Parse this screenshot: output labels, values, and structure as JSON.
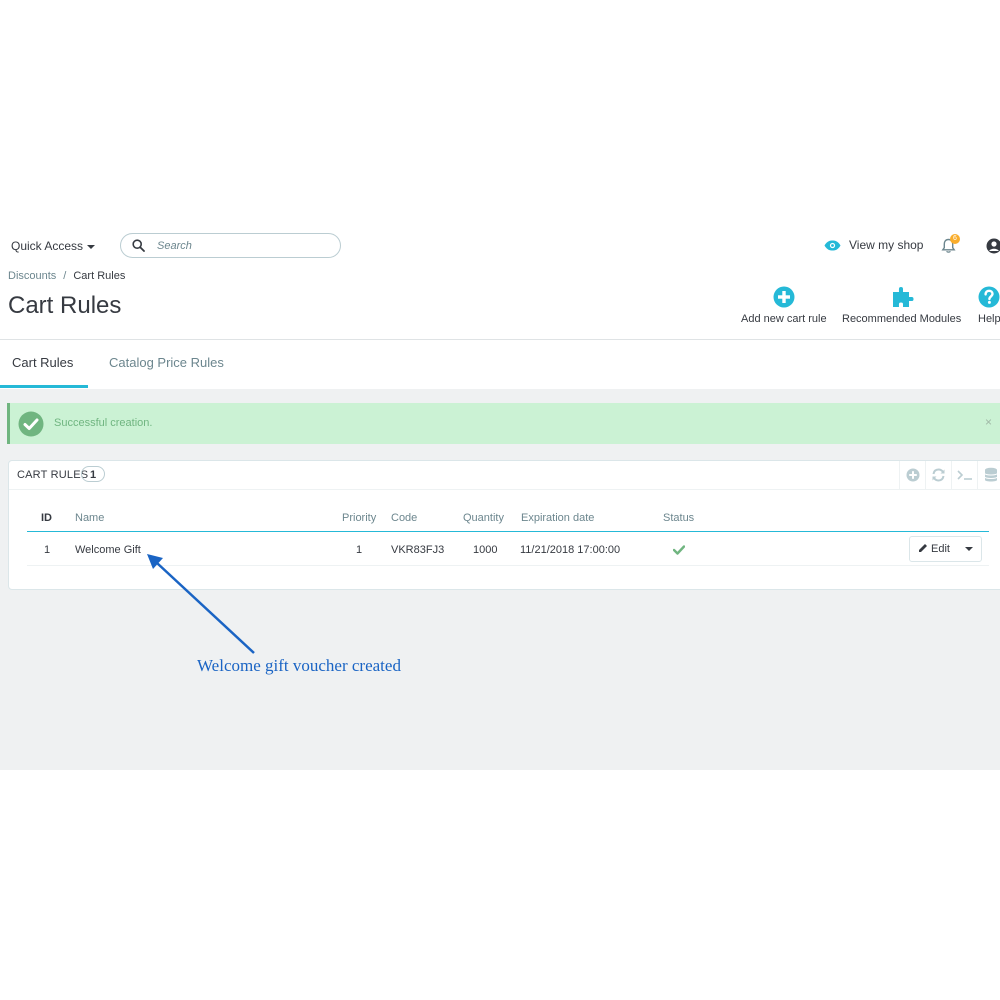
{
  "header": {
    "quick_access": "Quick Access",
    "search_placeholder": "Search",
    "view_shop": "View my shop",
    "notification_count": "6"
  },
  "breadcrumb": {
    "parent": "Discounts",
    "separator": "/",
    "current": "Cart Rules"
  },
  "page_title": "Cart Rules",
  "toolbar": {
    "add_new": "Add new cart rule",
    "recommended": "Recommended Modules",
    "help": "Help"
  },
  "tabs": [
    {
      "label": "Cart Rules",
      "active": true
    },
    {
      "label": "Catalog Price Rules",
      "active": false
    }
  ],
  "alert": {
    "text": "Successful creation.",
    "close": "×"
  },
  "panel": {
    "title": "CART RULES",
    "count": "1"
  },
  "table": {
    "headers": {
      "id": "ID",
      "name": "Name",
      "priority": "Priority",
      "code": "Code",
      "quantity": "Quantity",
      "expiration": "Expiration date",
      "status": "Status"
    },
    "rows": [
      {
        "id": "1",
        "name": "Welcome Gift",
        "priority": "1",
        "code": "VKR83FJ3",
        "quantity": "1000",
        "expiration": "11/21/2018 17:00:00",
        "status": "enabled"
      }
    ],
    "edit_label": "Edit"
  },
  "annotation": {
    "text": "Welcome gift voucher created",
    "color": "#1a64c4"
  },
  "colors": {
    "accent": "#25b9d7",
    "success": "#70b580",
    "success_bg": "#cbf2d4",
    "content_bg": "#eff1f2"
  }
}
